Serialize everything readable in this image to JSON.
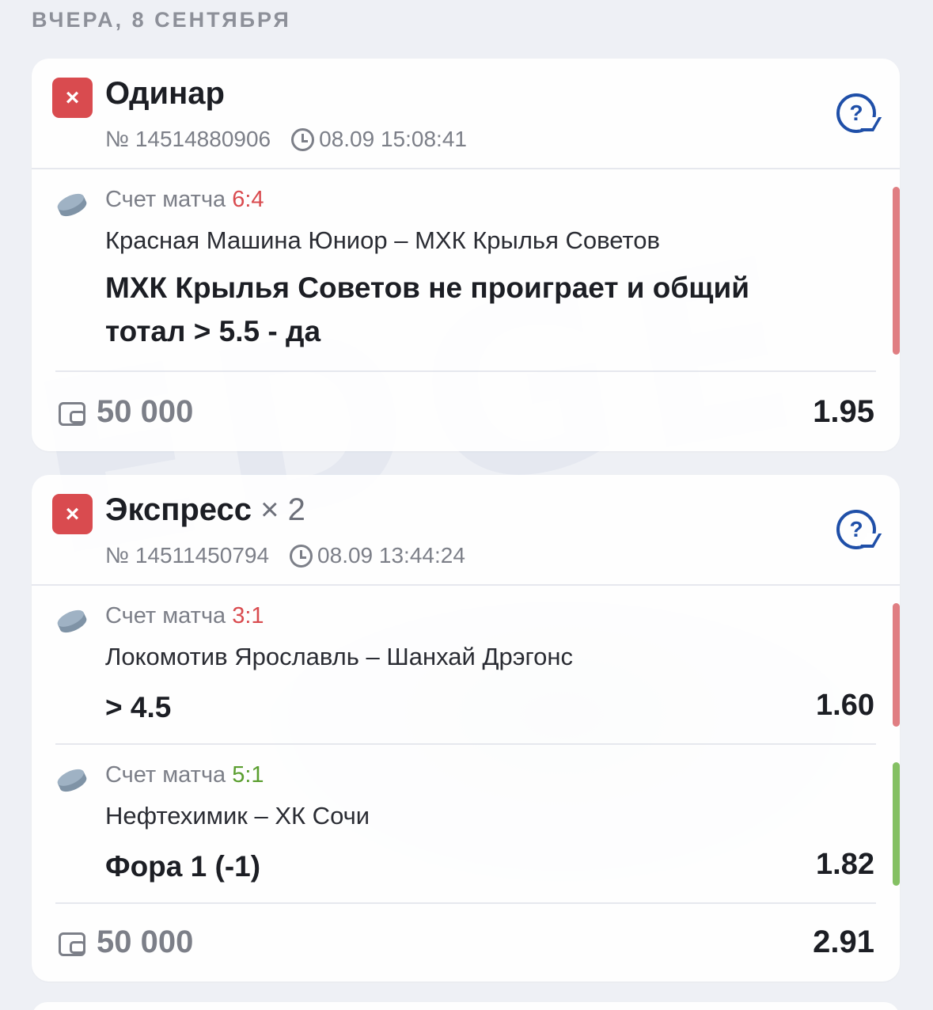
{
  "day_header": "ВЧЕРА, 8 СЕНТЯБРЯ",
  "icons": {
    "status": "close-x-icon",
    "help": "question-bubble-icon",
    "clock": "clock-icon",
    "sport": "hockey-puck-icon",
    "wallet": "wallet-icon"
  },
  "colors": {
    "lost": "#d94b4f",
    "won": "#84c063",
    "help_blue": "#1f4fa8"
  },
  "bets": [
    {
      "status_symbol": "×",
      "type": "Одинар",
      "multiplier": "",
      "number": "№ 14514880906",
      "time": "08.09 15:08:41",
      "events": [
        {
          "score_label": "Счет матча",
          "score": "6:4",
          "teams": "Красная Машина Юниор – МХК Крылья Советов",
          "pick": "МХК Крылья Советов не проиграет и общий тотал > 5.5 - да",
          "coef": "",
          "result": "lost"
        }
      ],
      "stake": "50 000",
      "total_coef": "1.95"
    },
    {
      "status_symbol": "×",
      "type": "Экспресс",
      "multiplier": "× 2",
      "number": "№ 14511450794",
      "time": "08.09 13:44:24",
      "events": [
        {
          "score_label": "Счет матча",
          "score": "3:1",
          "teams": "Локомотив Ярославль – Шанхай Дрэгонс",
          "pick": "> 4.5",
          "coef": "1.60",
          "result": "lost"
        },
        {
          "score_label": "Счет матча",
          "score": "5:1",
          "teams": "Нефтехимик – ХК Сочи",
          "pick": "Фора 1 (-1)",
          "coef": "1.82",
          "result": "won"
        }
      ],
      "stake": "50 000",
      "total_coef": "2.91"
    }
  ]
}
